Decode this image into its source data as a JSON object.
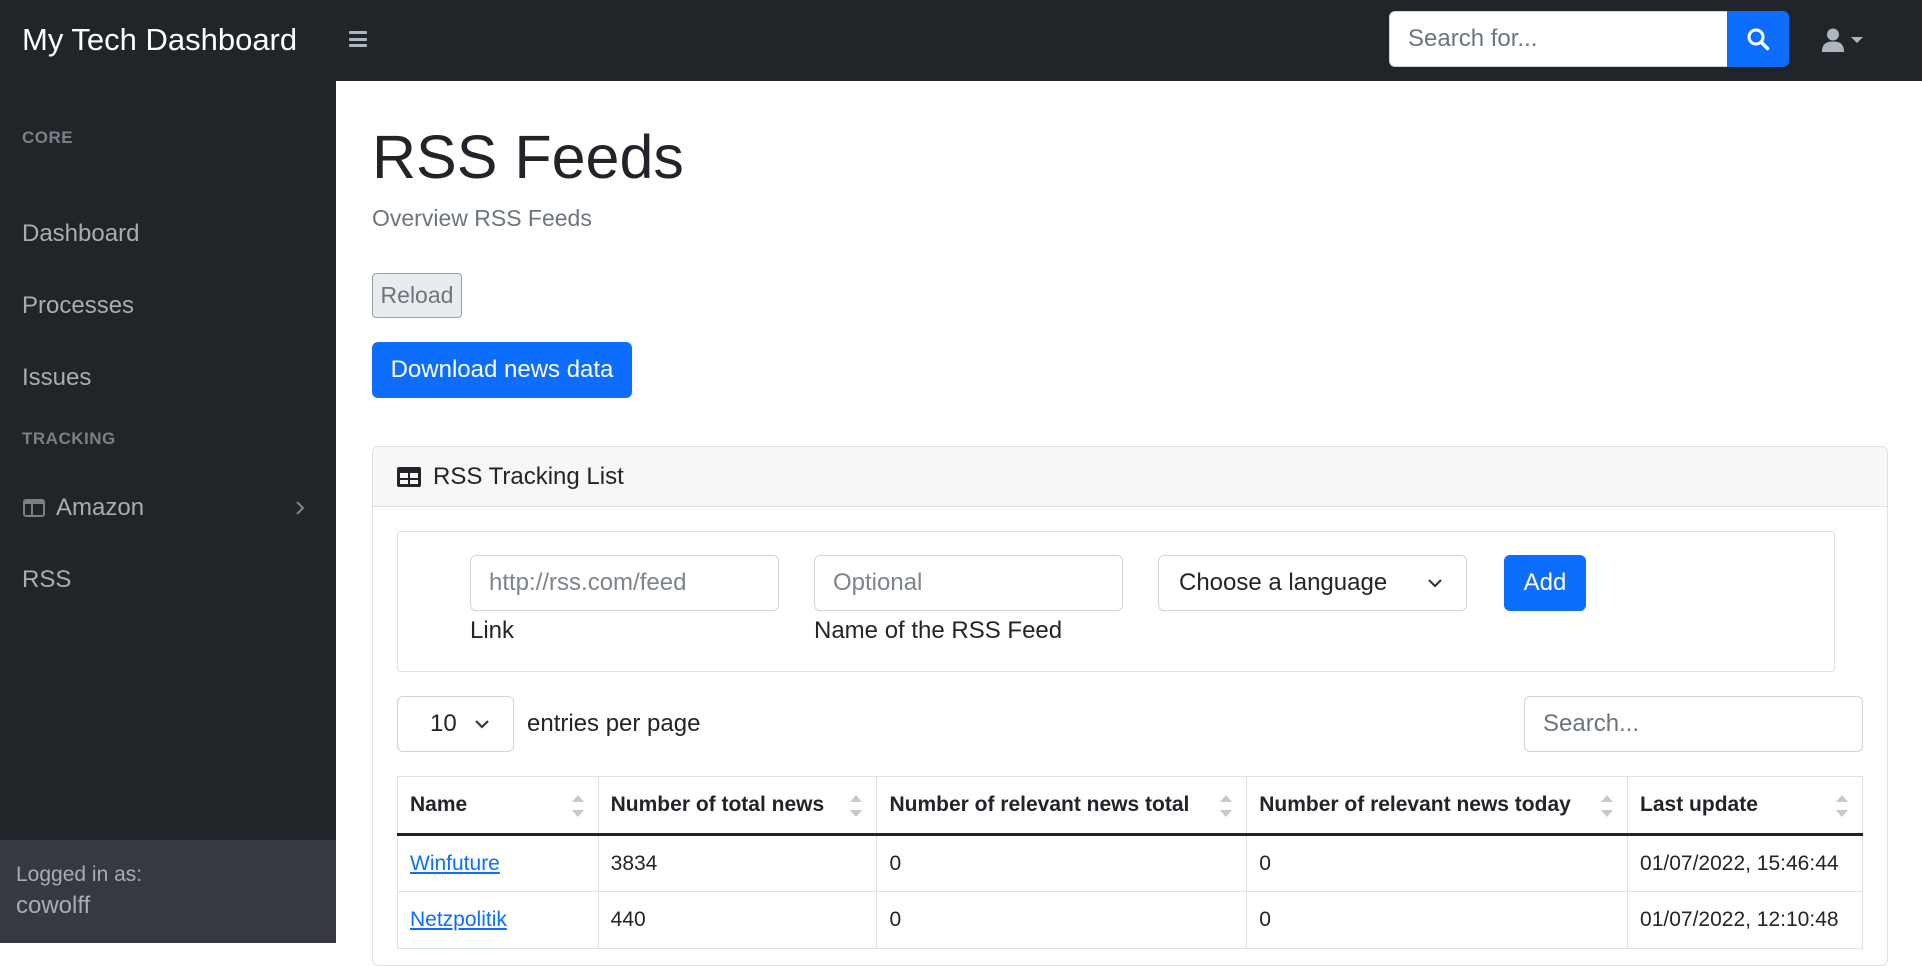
{
  "app": {
    "brand": "My Tech Dashboard"
  },
  "topbar": {
    "search_placeholder": "Search for..."
  },
  "sidebar": {
    "sections": [
      {
        "heading": "CORE"
      },
      {
        "heading": "TRACKING"
      }
    ],
    "items": [
      {
        "label": "Dashboard"
      },
      {
        "label": "Processes"
      },
      {
        "label": "Issues"
      },
      {
        "label": "Amazon",
        "icon": "columns-icon",
        "has_submenu": true
      },
      {
        "label": "RSS"
      }
    ],
    "footer": {
      "logged_in_label": "Logged in as:",
      "username": "cowolff"
    }
  },
  "page": {
    "title": "RSS Feeds",
    "subtitle": "Overview RSS Feeds",
    "reload_label": "Reload",
    "download_label": "Download news data"
  },
  "card": {
    "title": "RSS Tracking List",
    "form": {
      "link_placeholder": "http://rss.com/feed",
      "link_label": "Link",
      "name_placeholder": "Optional",
      "name_label": "Name of the RSS Feed",
      "language_selected": "Choose a language",
      "add_label": "Add"
    },
    "table_controls": {
      "per_page_value": "10",
      "per_page_label": "entries per page",
      "search_placeholder": "Search..."
    },
    "table": {
      "columns": [
        "Name",
        "Number of total news",
        "Number of relevant news total",
        "Number of relevant news today",
        "Last update"
      ],
      "rows": [
        [
          "Winfuture",
          "3834",
          "0",
          "0",
          "01/07/2022, 15:46:44"
        ],
        [
          "Netzpolitik",
          "440",
          "0",
          "0",
          "01/07/2022, 12:10:48"
        ]
      ]
    }
  },
  "colors": {
    "primary": "#0d6efd",
    "navbar_bg": "#212529",
    "sidebar_footer_bg": "#343a40"
  }
}
